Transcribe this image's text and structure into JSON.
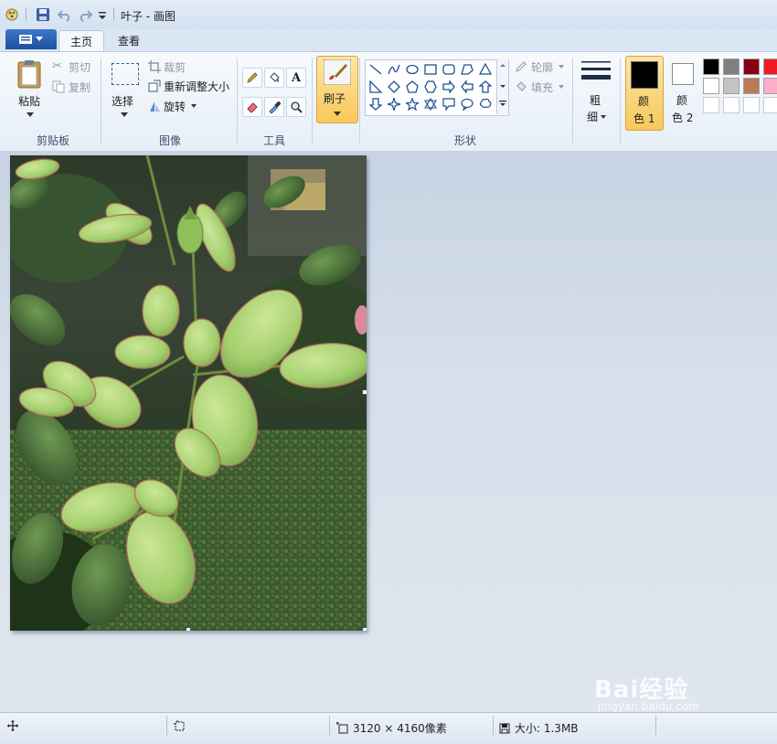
{
  "titlebar": {
    "title": "叶子 - 画图"
  },
  "tabs": {
    "home": "主页",
    "view": "查看"
  },
  "clipboard": {
    "paste": "粘贴",
    "cut": "剪切",
    "copy": "复制",
    "group": "剪贴板"
  },
  "image": {
    "select": "选择",
    "crop": "裁剪",
    "resize": "重新调整大小",
    "rotate": "旋转",
    "group": "图像"
  },
  "tools": {
    "group": "工具",
    "text_tool": "A"
  },
  "brushes": {
    "label": "刷子"
  },
  "shapes": {
    "outline": "轮廓",
    "fill": "填充",
    "group": "形状"
  },
  "size": {
    "line1": "粗",
    "line2": "细"
  },
  "colors": {
    "color1_l1": "颜",
    "color1_l2": "色 1",
    "color2_l1": "颜",
    "color2_l2": "色 2",
    "color1_value": "#000000",
    "color2_value": "#ffffff",
    "palette": [
      "#000000",
      "#7f7f7f",
      "#880015",
      "#ed1c24",
      "#ffffff",
      "#c3c3c3",
      "#b97a57",
      "#ffaec9",
      "#ffffff",
      "#ffffff",
      "#ffffff",
      "#ffffff"
    ]
  },
  "status": {
    "dimensions": "3120 × 4160像素",
    "size": "大小: 1.3MB"
  },
  "watermark": {
    "brand": "Bai经验",
    "url": "jingyan.baidu.com"
  }
}
